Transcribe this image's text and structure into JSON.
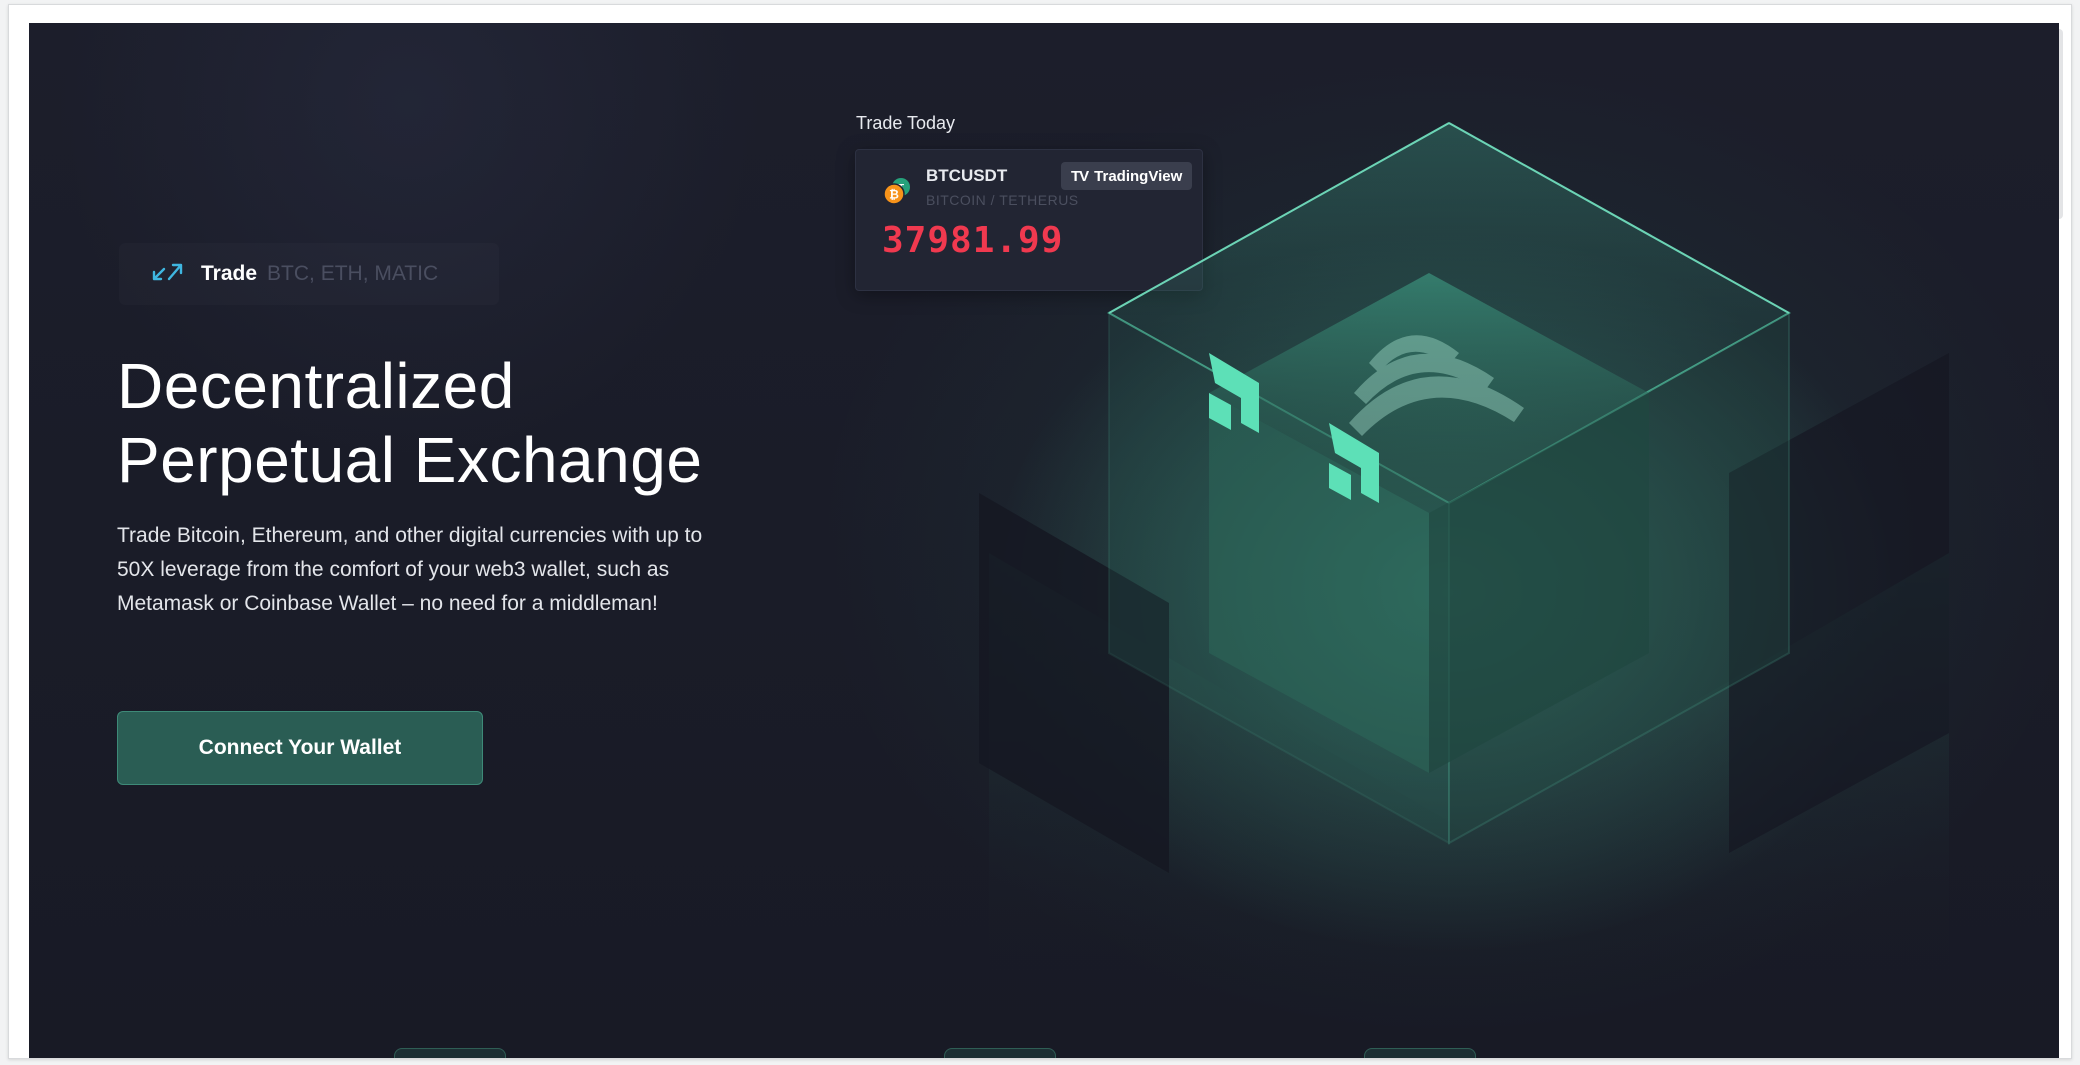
{
  "hero": {
    "tag": {
      "label": "Trade",
      "assets": "BTC, ETH, MATIC",
      "icon": "arrows-exchange-icon"
    },
    "headline_line1": "Decentralized",
    "headline_line2": "Perpetual Exchange",
    "description": "Trade Bitcoin, Ethereum, and other digital currencies with up to 50X leverage from the comfort of your web3 wallet, such as Metamask or Coinbase Wallet – no need for a middleman!",
    "cta_label": "Connect Your Wallet"
  },
  "widget": {
    "title": "Trade Today",
    "symbol": "BTCUSDT",
    "pair": "BITCOIN / TETHERUS",
    "provider": "TradingView",
    "provider_logo": "TV",
    "price": "37981.99",
    "coin_icon": "bitcoin-tether-icon"
  },
  "colors": {
    "background": "#1b1d29",
    "accent": "#2a5d54",
    "accent_glow": "#5de0b7",
    "price_down": "#f0394f",
    "tag_icon": "#3fb6e0"
  }
}
